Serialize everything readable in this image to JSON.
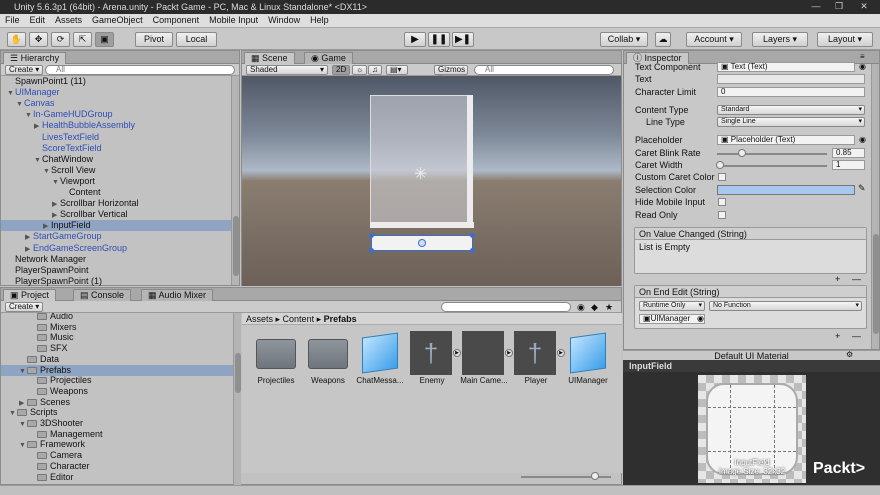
{
  "window": {
    "title": "Unity 5.6.3p1 (64bit) - Arena.unity - Packt Game - PC, Mac & Linux Standalone* <DX11>"
  },
  "menu": [
    "File",
    "Edit",
    "Assets",
    "GameObject",
    "Component",
    "Mobile Input",
    "Window",
    "Help"
  ],
  "toolbar": {
    "pivot": "Pivot",
    "local": "Local",
    "collab": "Collab ▾",
    "account": "Account",
    "layers": "Layers",
    "layout": "Layout"
  },
  "hierarchy": {
    "tab": "Hierarchy",
    "create": "Create",
    "search_placeholder": "All",
    "rows": [
      {
        "label": "SpawnPoint1 (11)",
        "depth": 0,
        "tri": "",
        "blue": false
      },
      {
        "label": "UIManager",
        "depth": 0,
        "tri": "▼",
        "blue": true
      },
      {
        "label": "Canvas",
        "depth": 1,
        "tri": "▼",
        "blue": true
      },
      {
        "label": "In-GameHUDGroup",
        "depth": 2,
        "tri": "▼",
        "blue": true
      },
      {
        "label": "HealthBubbleAssembly",
        "depth": 3,
        "tri": "▶",
        "blue": true
      },
      {
        "label": "LivesTextField",
        "depth": 3,
        "tri": "",
        "blue": true
      },
      {
        "label": "ScoreTextField",
        "depth": 3,
        "tri": "",
        "blue": true
      },
      {
        "label": "ChatWindow",
        "depth": 3,
        "tri": "▼",
        "blue": false
      },
      {
        "label": "Scroll View",
        "depth": 4,
        "tri": "▼",
        "blue": false
      },
      {
        "label": "Viewport",
        "depth": 5,
        "tri": "▼",
        "blue": false
      },
      {
        "label": "Content",
        "depth": 6,
        "tri": "",
        "blue": false
      },
      {
        "label": "Scrollbar Horizontal",
        "depth": 5,
        "tri": "▶",
        "blue": false
      },
      {
        "label": "Scrollbar Vertical",
        "depth": 5,
        "tri": "▶",
        "blue": false
      },
      {
        "label": "InputField",
        "depth": 4,
        "tri": "▶",
        "blue": false,
        "selected": true
      },
      {
        "label": "StartGameGroup",
        "depth": 2,
        "tri": "▶",
        "blue": true
      },
      {
        "label": "EndGameScreenGroup",
        "depth": 2,
        "tri": "▶",
        "blue": true
      },
      {
        "label": "Network Manager",
        "depth": 0,
        "tri": "",
        "blue": false
      },
      {
        "label": "PlayerSpawnPoint",
        "depth": 0,
        "tri": "",
        "blue": false
      },
      {
        "label": "PlayerSpawnPoint (1)",
        "depth": 0,
        "tri": "",
        "blue": false
      }
    ]
  },
  "scene": {
    "tabs": [
      "Scene",
      "Game"
    ],
    "shading": "Shaded",
    "mode": "2D",
    "gizmos": "Gizmos ▾",
    "search_placeholder": "All"
  },
  "project": {
    "tabs": [
      "Project",
      "Console",
      "Audio Mixer"
    ],
    "create": "Create",
    "tree": [
      {
        "label": "Audio",
        "depth": 2,
        "tri": ""
      },
      {
        "label": "Mixers",
        "depth": 2,
        "tri": ""
      },
      {
        "label": "Music",
        "depth": 2,
        "tri": ""
      },
      {
        "label": "SFX",
        "depth": 2,
        "tri": ""
      },
      {
        "label": "Data",
        "depth": 1,
        "tri": ""
      },
      {
        "label": "Prefabs",
        "depth": 1,
        "tri": "▼",
        "selected": true
      },
      {
        "label": "Projectiles",
        "depth": 2,
        "tri": ""
      },
      {
        "label": "Weapons",
        "depth": 2,
        "tri": ""
      },
      {
        "label": "Scenes",
        "depth": 1,
        "tri": "▶"
      },
      {
        "label": "Scripts",
        "depth": 0,
        "tri": "▼"
      },
      {
        "label": "3DShooter",
        "depth": 1,
        "tri": "▼"
      },
      {
        "label": "Management",
        "depth": 2,
        "tri": ""
      },
      {
        "label": "Framework",
        "depth": 1,
        "tri": "▼"
      },
      {
        "label": "Camera",
        "depth": 2,
        "tri": ""
      },
      {
        "label": "Character",
        "depth": 2,
        "tri": ""
      },
      {
        "label": "Editor",
        "depth": 2,
        "tri": ""
      }
    ],
    "breadcrumb": [
      "Assets",
      "Content",
      "Prefabs"
    ],
    "assets": [
      {
        "label": "Projectiles",
        "kind": "folder"
      },
      {
        "label": "Weapons",
        "kind": "folder"
      },
      {
        "label": "ChatMessa...",
        "kind": "cube"
      },
      {
        "label": "Enemy",
        "kind": "figure"
      },
      {
        "label": "Main Came...",
        "kind": "dark"
      },
      {
        "label": "Player",
        "kind": "figure"
      },
      {
        "label": "UIManager",
        "kind": "cube"
      }
    ]
  },
  "inspector": {
    "tab": "Inspector",
    "text_component_label": "Text Component",
    "text_component_value": "Text (Text)",
    "text_label": "Text",
    "char_limit_label": "Character Limit",
    "char_limit_value": "0",
    "content_type_label": "Content Type",
    "content_type_value": "Standard",
    "line_type_label": "Line Type",
    "line_type_value": "Single Line",
    "placeholder_label": "Placeholder",
    "placeholder_value": "Placeholder (Text)",
    "caret_blink_label": "Caret Blink Rate",
    "caret_blink_value": "0.85",
    "caret_width_label": "Caret Width",
    "caret_width_value": "1",
    "custom_caret_label": "Custom Caret Color",
    "selection_color_label": "Selection Color",
    "hide_mobile_label": "Hide Mobile Input",
    "read_only_label": "Read Only",
    "on_value_changed": "On Value Changed (String)",
    "list_empty": "List is Empty",
    "on_end_edit": "On End Edit (String)",
    "runtime_only": "Runtime Only",
    "no_function": "No Function",
    "target_object": "UIManager",
    "material_title": "Default UI Material",
    "preview_title": "InputField",
    "preview_caption_1": "InputField",
    "preview_caption_2": "Image Size: 32x32",
    "selection_color": "#a9c8f0"
  },
  "watermark": "Packt>"
}
